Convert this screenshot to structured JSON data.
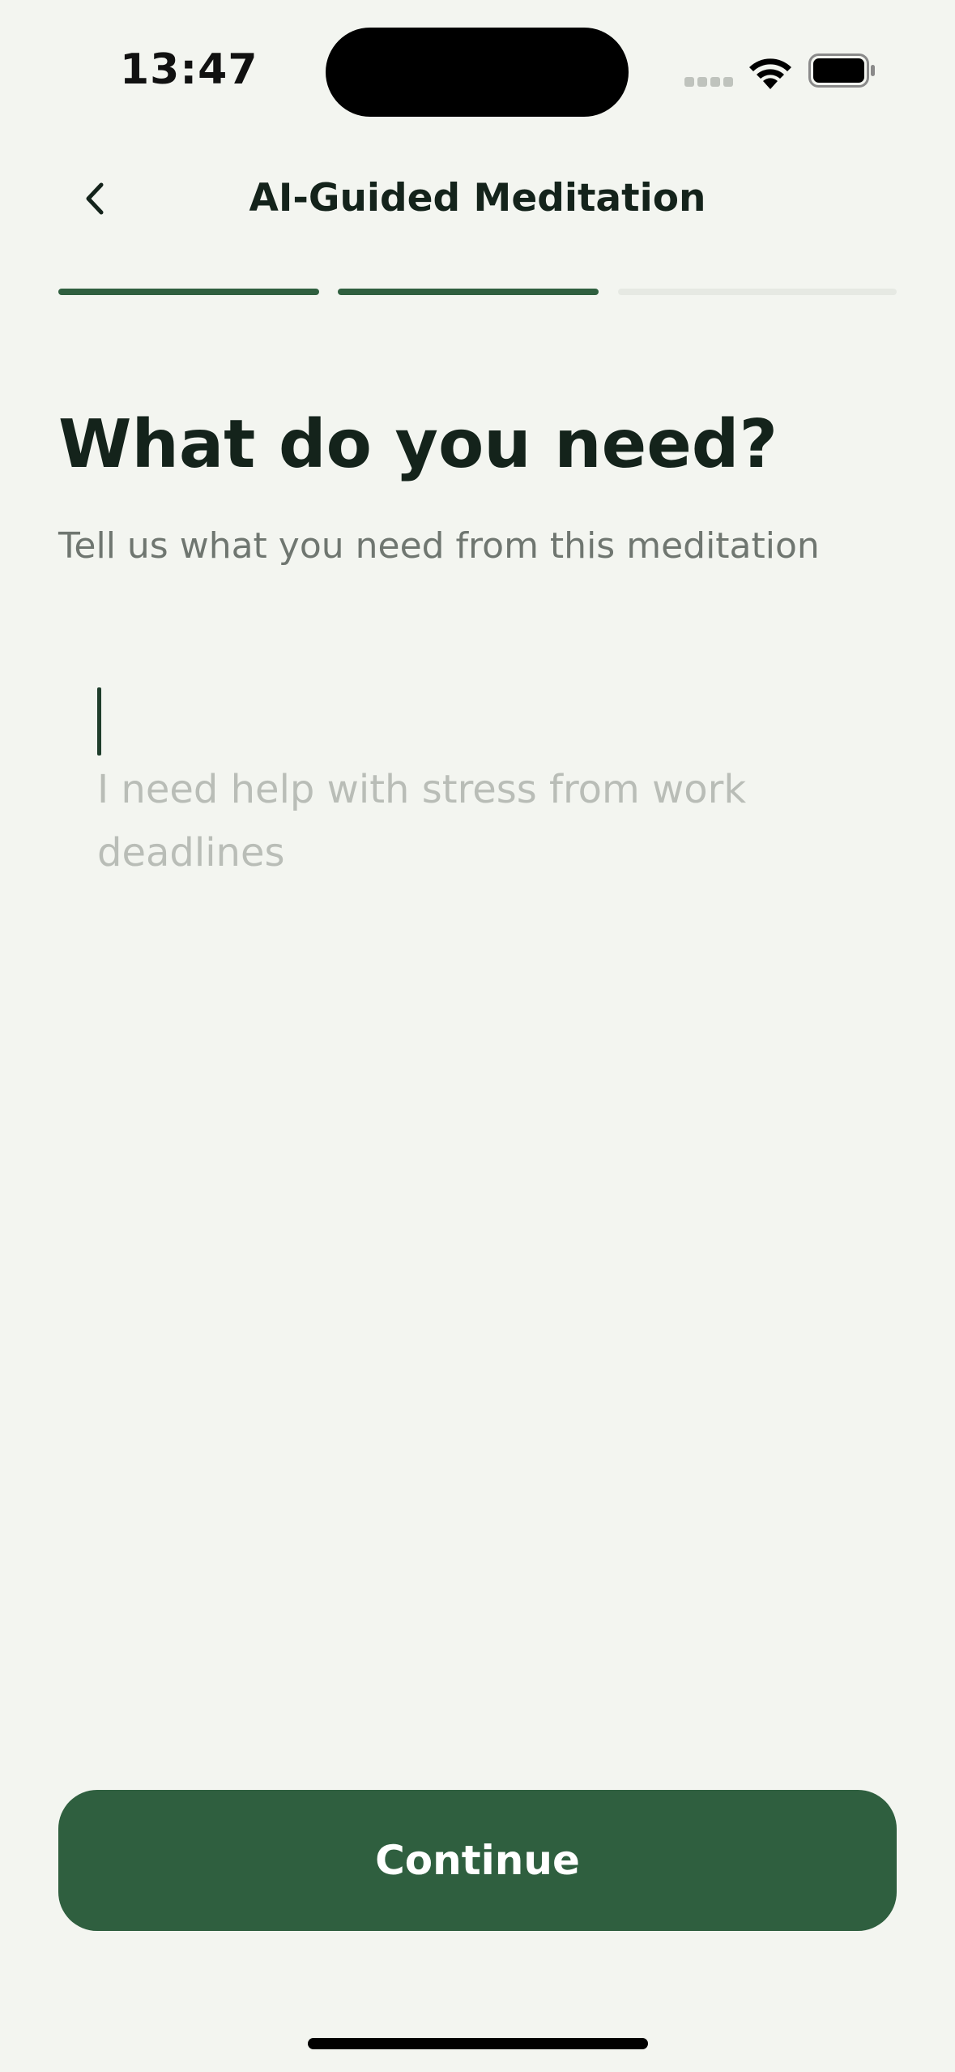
{
  "status_bar": {
    "time": "13:47"
  },
  "header": {
    "title": "AI-Guided Meditation",
    "back_icon": "chevron-left-icon"
  },
  "progress": {
    "total_steps": 3,
    "current_step": 2,
    "active_color": "#2f5f3f",
    "inactive_color": "#e6e9e3"
  },
  "main": {
    "heading": "What do you need?",
    "subheading": "Tell us what you need from this meditation",
    "input": {
      "value": "",
      "placeholder": "I need help with stress from work deadlines"
    }
  },
  "footer": {
    "continue_label": "Continue"
  },
  "colors": {
    "background": "#f3f5f0",
    "accent": "#2f5f3f",
    "text": "#14231b",
    "muted": "#6f7670",
    "placeholder": "#b9bdb7"
  }
}
